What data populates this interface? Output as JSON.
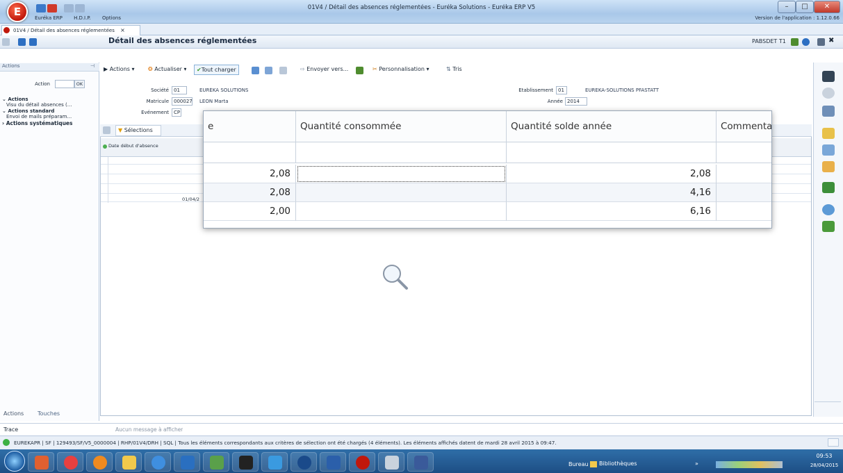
{
  "window": {
    "title": "01V4 / Détail des absences réglementées - Euréka Solutions - Euréka ERP V5",
    "logo_letter": "E"
  },
  "menu": {
    "items": [
      "Euréka ERP",
      "H.D.I.P.",
      "Options"
    ],
    "version": "Version de l'application : 1.12.0.66"
  },
  "doc_tab": {
    "label": "01V4 / Détail des absences réglementées",
    "close": "×"
  },
  "header": {
    "title": "Détail des absences réglementées",
    "code": "PABSDET T1"
  },
  "left_panel": {
    "header": "Actions",
    "action_label": "Action",
    "ok": "OK",
    "tree": [
      "Actions",
      "Visu du détail absences (...",
      "Actions standard",
      "Envoi de mails préparam...",
      "Actions systématiques"
    ],
    "bottom_tabs": [
      "Actions",
      "Touches"
    ]
  },
  "toolbar": {
    "actions": "Actions",
    "refresh": "Actualiser",
    "load_all": "Tout charger",
    "send_to": "Envoyer vers...",
    "customize": "Personnalisation",
    "sort": "Tris"
  },
  "form": {
    "societe_label": "Société",
    "societe": "01",
    "societe_name": "EURÉKA SOLUTIONS",
    "matricule_label": "Matricule",
    "matricule": "000027",
    "matricule_name": "LEON Marta",
    "evenement_label": "Evénement",
    "evenement": "CP",
    "etab_label": "Etablissement",
    "etab": "01",
    "etab_name": "EUREKA-SOLUTIONS PFASTATT",
    "annee_label": "Année",
    "annee": "2014"
  },
  "grid": {
    "selections": "Sélections",
    "col1": "Date début d'absence",
    "partial_date": "01/04/2"
  },
  "popup": {
    "headers": [
      "e",
      "Quantité consommée",
      "Quantité solde année",
      "Commentai"
    ],
    "rows": [
      [
        "2,08",
        "",
        "2,08",
        ""
      ],
      [
        "2,08",
        "",
        "4,16",
        ""
      ],
      [
        "2,00",
        "",
        "6,16",
        ""
      ]
    ]
  },
  "trace": {
    "label": "Trace",
    "message": "Aucun message à afficher"
  },
  "status": {
    "text": "EUREKAPR  |  SF  |  129493/SF/V5_0000004  |  RHP/01V4/DRH  |  SQL  |  Tous les éléments correspondants aux critères de sélection ont été chargés (4 éléments).   Les éléments affichés datent de mardi 28 avril 2015 à 09:47."
  },
  "taskbar": {
    "bureau": "Bureau",
    "libraries": "Bibliothèques",
    "time": "09:53",
    "date": "28/04/2015"
  }
}
